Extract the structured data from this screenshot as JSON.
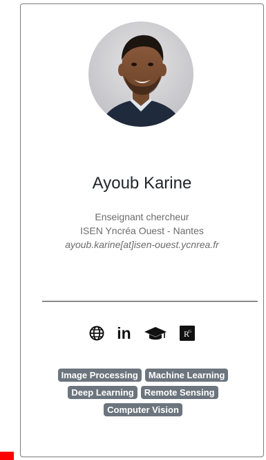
{
  "profile": {
    "name": "Ayoub Karine",
    "role": "Enseignant chercheur",
    "organization": "ISEN Yncréa Ouest - Nantes",
    "email": "ayoub.karine[at]isen-ouest.ycnrea.fr"
  },
  "social_links": [
    {
      "icon": "globe-icon"
    },
    {
      "icon": "linkedin-icon",
      "label": "in"
    },
    {
      "icon": "graduation-cap-icon"
    },
    {
      "icon": "researchgate-icon",
      "label": "R"
    }
  ],
  "tags": [
    "Image Processing",
    "Machine Learning",
    "Deep Learning",
    "Remote Sensing",
    "Computer Vision"
  ],
  "colors": {
    "tag_background": "#6c757d",
    "card_border": "#7a7a7a",
    "corner_marker": "#ff0000"
  }
}
